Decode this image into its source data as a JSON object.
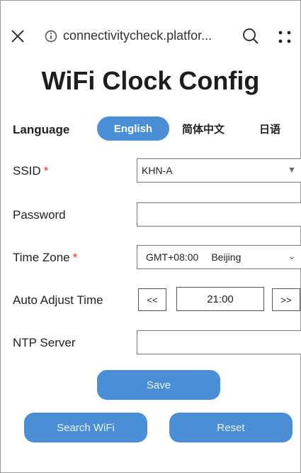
{
  "browser": {
    "url": "connectivitycheck.platfor...",
    "icons": [
      "close-icon",
      "info-icon",
      "search-icon",
      "more-icon"
    ]
  },
  "page": {
    "title": "WiFi Clock Config"
  },
  "language": {
    "label": "Language",
    "options": [
      "English",
      "简体中文",
      "日语"
    ],
    "selected": "English"
  },
  "form": {
    "ssid": {
      "label": "SSID",
      "required": "*",
      "value": "KHN-A"
    },
    "password": {
      "label": "Password",
      "value": ""
    },
    "timezone": {
      "label": "Time Zone",
      "required": "*",
      "offset": "GMT+08:00",
      "city": "Beijing"
    },
    "auto_adjust": {
      "label": "Auto Adjust Time",
      "prev": "<<",
      "time": "21:00",
      "next": ">>"
    },
    "ntp": {
      "label": "NTP Server",
      "value": ""
    }
  },
  "actions": {
    "save": "Save",
    "search_wifi": "Search WiFi",
    "reset": "Reset"
  },
  "colors": {
    "accent": "#4a8fd6",
    "required": "#dd3333"
  }
}
